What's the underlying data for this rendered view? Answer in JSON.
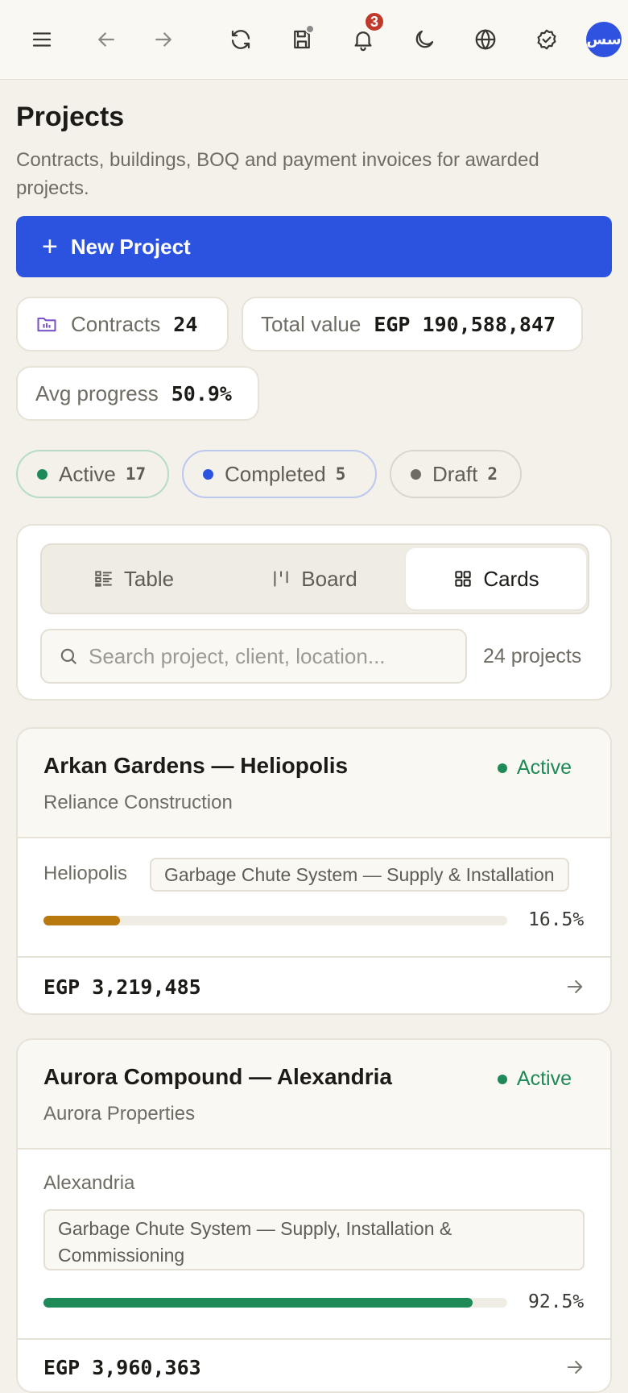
{
  "topbar": {
    "notifications_count": "3",
    "avatar_initials": "سس"
  },
  "header": {
    "title": "Projects",
    "subtitle": "Contracts, buildings, BOQ and payment invoices for awarded projects.",
    "new_button": "New Project"
  },
  "stats": {
    "contracts_label": "Contracts",
    "contracts_value": "24",
    "total_label": "Total value",
    "total_value": "EGP 190,588,847",
    "avg_label": "Avg progress",
    "avg_value": "50.9%"
  },
  "status_chips": [
    {
      "label": "Active",
      "count": "17",
      "color": "#1e8a57"
    },
    {
      "label": "Completed",
      "count": "5",
      "color": "#2c52e0"
    },
    {
      "label": "Draft",
      "count": "2",
      "color": "#6f6c64"
    }
  ],
  "view": {
    "tabs": [
      "Table",
      "Board",
      "Cards"
    ],
    "active_tab": "Cards",
    "search_placeholder": "Search project, client, location...",
    "count_text": "24 projects"
  },
  "projects": [
    {
      "title": "Arkan Gardens — Heliopolis",
      "client": "Reliance Construction",
      "status": "Active",
      "location": "Heliopolis",
      "scope": "Garbage Chute System — Supply & Installation",
      "progress": 16.5,
      "progress_text": "16.5%",
      "progress_color": "#b8790f",
      "amount": "EGP 3,219,485"
    },
    {
      "title": "Aurora Compound — Alexandria",
      "client": "Aurora Properties",
      "status": "Active",
      "location": "Alexandria",
      "scope": "Garbage Chute System — Supply, Installation & Commissioning",
      "progress": 92.5,
      "progress_text": "92.5%",
      "progress_color": "#1e8a57",
      "amount": "EGP 3,960,363"
    }
  ]
}
